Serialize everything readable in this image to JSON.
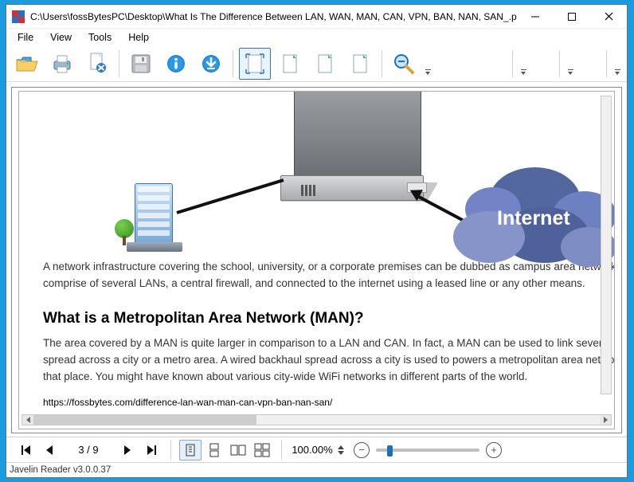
{
  "window": {
    "title": "C:\\Users\\fossBytesPC\\Desktop\\What Is The Difference Between LAN, WAN, MAN, CAN, VPN, BAN, NAN, SAN_.pdf"
  },
  "menu": {
    "file": "File",
    "view": "View",
    "tools": "Tools",
    "help": "Help"
  },
  "toolbar": {
    "open": "open-icon",
    "print": "print-icon",
    "delete": "remove-doc-icon",
    "save": "save-icon",
    "info": "info-icon",
    "download": "download-icon",
    "fit_page": "fit-page-icon",
    "rotate1": "page-variant-1",
    "rotate2": "page-variant-2",
    "rotate3": "page-variant-3",
    "zoom": "zoom-out-icon"
  },
  "page": {
    "paragraph1": "A network infrastructure covering the school, university, or a corporate premises can be dubbed as campus area network. It can comprise of several LANs, a central firewall, and connected to the internet using a leased line or any other means.",
    "heading": "What is a Metropolitan Area Network (MAN)?",
    "paragraph2": "The area covered by a MAN is quite larger in comparison to a LAN and CAN. In fact, a MAN can be used to link several LANs spread across a city or a metro area. A wired backhaul spread across a city is used to powers a metropolitan area network in that place. You might have known about various city-wide WiFi networks in different parts of the world.",
    "url": "https://fossbytes.com/difference-lan-wan-man-can-vpn-ban-nan-san/",
    "cloud_label": "Internet"
  },
  "nav": {
    "page_display": "3 / 9",
    "zoom_display": "100.00%"
  },
  "status": {
    "text": "Javelin Reader v3.0.0.37"
  }
}
